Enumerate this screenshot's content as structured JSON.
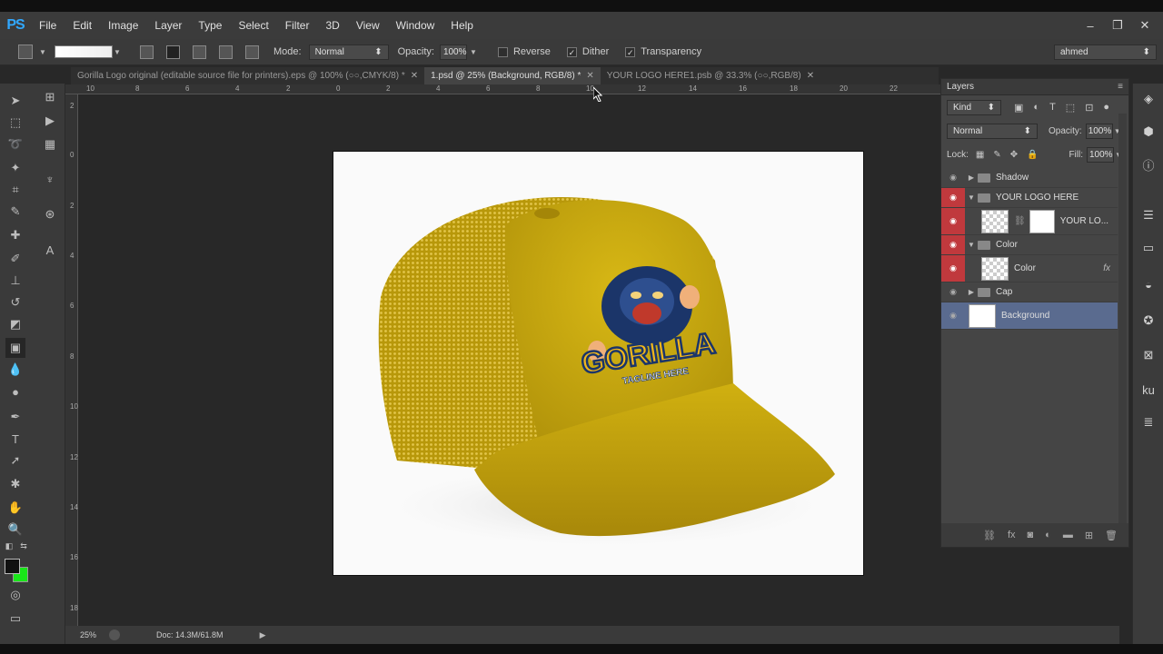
{
  "app": {
    "logo": "PS"
  },
  "menu": [
    "File",
    "Edit",
    "Image",
    "Layer",
    "Type",
    "Select",
    "Filter",
    "3D",
    "View",
    "Window",
    "Help"
  ],
  "window_buttons": {
    "minimize": "‒",
    "restore": "❐",
    "close": "✕"
  },
  "options": {
    "mode_label": "Mode:",
    "mode_value": "Normal",
    "opacity_label": "Opacity:",
    "opacity_value": "100%",
    "reverse_label": "Reverse",
    "dither_label": "Dither",
    "transparency_label": "Transparency",
    "workspace": "ahmed"
  },
  "tabs": [
    {
      "label": "Gorilla Logo original (editable source file for printers).eps @ 100% (○○,CMYK/8) *",
      "close": "✕"
    },
    {
      "label": "1.psd @ 25% (Background, RGB/8) *",
      "close": "✕"
    },
    {
      "label": "YOUR LOGO HERE1.psb @ 33.3% (○○,RGB/8)",
      "close": "✕"
    }
  ],
  "ruler_h": [
    "10",
    "8",
    "6",
    "4",
    "2",
    "0",
    "2",
    "4",
    "6",
    "8",
    "10",
    "12",
    "14",
    "16",
    "18",
    "20",
    "22"
  ],
  "ruler_v": [
    "2",
    "0",
    "2",
    "4",
    "6",
    "8",
    "10",
    "12",
    "14",
    "16",
    "18"
  ],
  "logo_artwork": {
    "word": "GORILLA",
    "tagline": "TAGLINE HERE"
  },
  "status": {
    "zoom": "25%",
    "doc": "Doc: 14.3M/61.8M"
  },
  "layers_panel": {
    "title": "Layers",
    "filter": "Kind",
    "blend_mode": "Normal",
    "opacity_label": "Opacity:",
    "opacity_value": "100%",
    "lock_label": "Lock:",
    "fill_label": "Fill:",
    "fill_value": "100%",
    "layers": [
      {
        "name": "Shadow"
      },
      {
        "name": "YOUR LOGO HERE"
      },
      {
        "name": "YOUR LO..."
      },
      {
        "name": "Color"
      },
      {
        "name": "Color",
        "fx": "fx"
      },
      {
        "name": "Cap"
      },
      {
        "name": "Background"
      }
    ]
  },
  "colors": {
    "foreground": "#111111",
    "background": "#19e619",
    "cap": "#c9a90d",
    "selection": "#5a6b8f"
  }
}
